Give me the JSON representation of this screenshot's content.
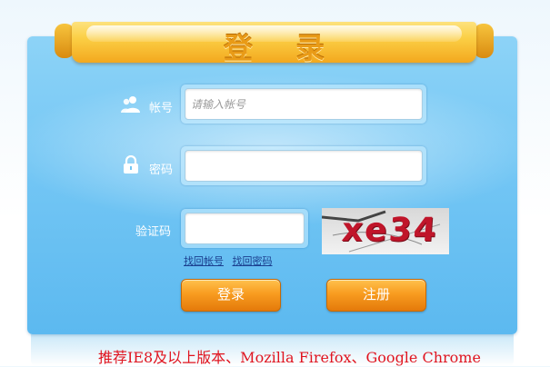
{
  "login_panel": {
    "title": "登 录",
    "username": {
      "label": "帐号",
      "icon": "users-icon",
      "placeholder": "请输入帐号",
      "value": ""
    },
    "password": {
      "label": "密码",
      "icon": "lock-icon",
      "value": ""
    },
    "captcha": {
      "label": "验证码",
      "value": "",
      "image_text": "xe34"
    },
    "links": {
      "find_account": "找回帐号",
      "find_password": "找回密码"
    },
    "buttons": {
      "login": "登录",
      "register": "注册"
    }
  },
  "footer": {
    "recommendation": "推荐IE8及以上版本、Mozilla Firefox、Google Chrome"
  },
  "colors": {
    "panel_blue": "#73c6f4",
    "ribbon_orange": "#f3a81e",
    "button_orange": "#f89c20",
    "footer_red": "#e0141f",
    "captcha_red": "#c0152a"
  }
}
